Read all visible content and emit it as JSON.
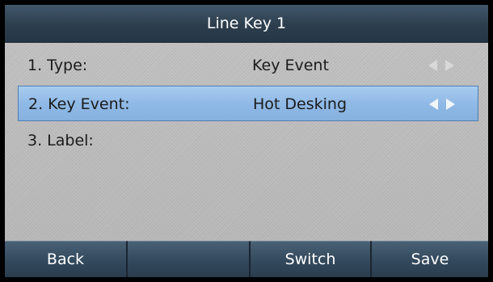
{
  "title": "Line Key 1",
  "rows": [
    {
      "label": "1. Type:",
      "value": "Key Event",
      "selected": false
    },
    {
      "label": "2. Key Event:",
      "value": "Hot Desking",
      "selected": true
    },
    {
      "label": "3. Label:",
      "value": "",
      "selected": false
    }
  ],
  "softkeys": [
    "Back",
    "",
    "Switch",
    "Save"
  ],
  "colors": {
    "titlebar": "#2c3e4e",
    "selection": "#8fb9e6",
    "background": "#bdbdbd"
  }
}
